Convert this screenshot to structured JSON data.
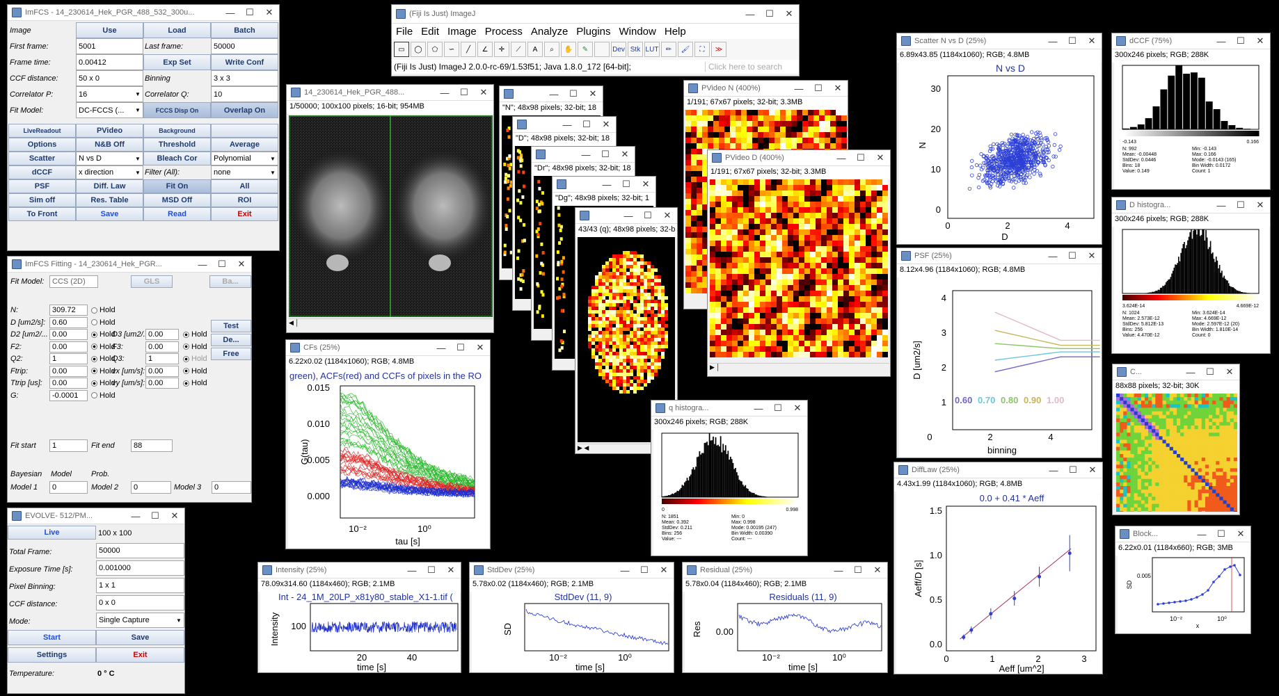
{
  "imfcs": {
    "title": "ImFCS - 14_230614_Hek_PGR_488_532_300u...",
    "rows": [
      [
        "Image",
        "Use",
        "Load",
        "Batch"
      ],
      [
        "First frame:",
        "5001",
        "Last frame:",
        "50000"
      ],
      [
        "Frame time:",
        "0.00412",
        "Exp Set",
        "Write Conf"
      ],
      [
        "CCF distance:",
        "50 x 0",
        "Binning",
        "3 x 3"
      ],
      [
        "Correlator P:",
        "16",
        "Correlator Q:",
        "10"
      ],
      [
        "Fit Model:",
        "DC-FCCS (...",
        "FCCS Disp On",
        "Overlap On"
      ]
    ],
    "buttons": [
      [
        "LiveReadout",
        "PVideo",
        "Background",
        ""
      ],
      [
        "Options",
        "N&B Off",
        "Threshold",
        "Average"
      ],
      [
        "Scatter",
        "N vs D",
        "Bleach Cor",
        "Polynomial"
      ],
      [
        "dCCF",
        "x direction",
        "Filter (All):",
        "none"
      ],
      [
        "PSF",
        "Diff. Law",
        "Fit On",
        "All"
      ],
      [
        "Sim off",
        "Res. Table",
        "MSD Off",
        "ROI"
      ],
      [
        "To Front",
        "Save",
        "Read",
        "Exit"
      ]
    ]
  },
  "fitting": {
    "title": "ImFCS Fitting - 14_230614_Hek_PGR...",
    "fit_model_label": "Fit Model:",
    "fit_model": "CCS (2D)",
    "gls": "GLS",
    "ba": "Ba...",
    "side_buttons": [
      "Test",
      "De...",
      "Free"
    ],
    "params_left": [
      [
        "N:",
        "309.72",
        "Hold"
      ],
      [
        "D [um2/s]:",
        "0.60",
        "Hold"
      ],
      [
        "D2 [um2/...",
        "0.00",
        "Hold"
      ],
      [
        "F2:",
        "0.00",
        "Hold"
      ],
      [
        "Q2:",
        "1",
        "Hold"
      ],
      [
        "Ftrip:",
        "0.00",
        "Hold"
      ],
      [
        "Ttrip [us]:",
        "0.00",
        "Hold"
      ],
      [
        "G:",
        "-0.0001",
        "Hold"
      ]
    ],
    "params_right": [
      [
        "D3 [um2/...",
        "0.00",
        "Hold"
      ],
      [
        "F3:",
        "0.00",
        "Hold"
      ],
      [
        "Q3:",
        "1",
        "Hold"
      ],
      [
        "vx [um/s]:",
        "0.00",
        "Hold"
      ],
      [
        "vy [um/s]:",
        "0.00",
        "Hold"
      ]
    ],
    "fit_start_label": "Fit start",
    "fit_start": "1",
    "fit_end_label": "Fit end",
    "fit_end": "88",
    "bayes_header": [
      "Bayesian",
      "Model",
      "Prob."
    ],
    "models": [
      "Model 1",
      "0",
      "Model 2",
      "0",
      "Model 3",
      "0"
    ]
  },
  "evolve": {
    "title": "EVOLVE- 512/PM...",
    "live": "Live",
    "live_val": "100 x 100",
    "rows": [
      [
        "Total Frame:",
        "50000"
      ],
      [
        "Exposure Time [s]:",
        "0.001000"
      ],
      [
        "Pixel Binning:",
        "1 x 1"
      ],
      [
        "CCF distance:",
        "0 x 0"
      ],
      [
        "Mode:",
        "Single Capture"
      ]
    ],
    "start": "Start",
    "save": "Save",
    "settings": "Settings",
    "exit": "Exit",
    "temp_label": "Temperature:",
    "temp": "0 ° C"
  },
  "imagej": {
    "title": "(Fiji Is Just) ImageJ",
    "menus": [
      "File",
      "Edit",
      "Image",
      "Process",
      "Analyze",
      "Plugins",
      "Window",
      "Help"
    ],
    "tools": [
      "Dev",
      "Stk",
      "LUT"
    ],
    "status": "(Fiji Is Just) ImageJ 2.0.0-rc-69/1.53f51; Java 1.8.0_172 [64-bit];",
    "search": "Click here to search"
  },
  "stack": {
    "title": "14_230614_Hek_PGR_488...",
    "info": "1/50000; 100x100 pixels; 16-bit; 954MB"
  },
  "param_maps": [
    {
      "title": "",
      "info": "\"N\"; 48x98 pixels; 32-bit; 18"
    },
    {
      "title": "",
      "info": "\"D\"; 48x98 pixels; 32-bit; 18"
    },
    {
      "title": "",
      "info": "\"Dr\"; 48x98 pixels; 32-bit; 18"
    },
    {
      "title": "",
      "info": "\"Dg\"; 48x98 pixels; 32-bit; 1"
    },
    {
      "title": "",
      "info": "43/43 (q); 48x98 pixels; 32-b"
    }
  ],
  "pvideo_n": {
    "title": "PVideo N (400%)",
    "info": "1/191; 67x67 pixels; 32-bit; 3.3MB"
  },
  "pvideo_d": {
    "title": "PVideo D (400%)",
    "info": "1/191; 67x67 pixels; 32-bit; 3.3MB"
  },
  "cfs": {
    "title": "CFs (25%)",
    "info": "6.22x0.02  (1184x1060); RGB; 4.8MB",
    "plot_title": "green), ACFs(red) and CCFs of pixels in the RO",
    "ylabel": "G(tau)",
    "xlabel": "tau [s]",
    "yticks": [
      "0.015",
      "0.010",
      "0.005",
      "0.000"
    ],
    "xticks": [
      "10⁻²",
      "10⁰"
    ]
  },
  "q_hist": {
    "title": "q histogra...",
    "info": "300x246 pixels; RGB; 288K",
    "range": [
      "0",
      "0.998"
    ],
    "stats_left": [
      "N: 1851",
      "Mean: 0.392",
      "StdDev: 0.211",
      "Bins: 256",
      "Value: ---"
    ],
    "stats_right": [
      "Min: 0",
      "Max: 0.998",
      "Mode: 0.00195 (247)",
      "Bin Width: 0.00390",
      "Count: ---"
    ]
  },
  "scatter": {
    "title": "Scatter N vs D (25%)",
    "info": "6.89x43.85  (1184x1060); RGB; 4.8MB",
    "plot_title": "N vs D",
    "xlabel": "D",
    "ylabel": "N",
    "xticks": [
      "0",
      "2",
      "4"
    ],
    "yticks": [
      "30",
      "20",
      "10",
      "0"
    ]
  },
  "psf": {
    "title": "PSF (25%)",
    "info": "8.12x4.96  (1184x1060); RGB; 4.8MB",
    "xlabel": "binning",
    "ylabel": "D [um2/s]",
    "xticks": [
      "0",
      "2",
      "4"
    ],
    "yticks": [
      "4",
      "3",
      "2",
      "1"
    ],
    "legend": [
      "0.60",
      "0.70",
      "0.80",
      "0.90",
      "1.00"
    ]
  },
  "difflaw": {
    "title": "DiffLaw (25%)",
    "info": "4.43x1.99  (1184x1060); RGB; 4.8MB",
    "plot_title": "0.0 + 0.41 * Aeff",
    "xlabel": "Aeff [um^2]",
    "ylabel": "Aeff/D [s]",
    "xticks": [
      "0",
      "1",
      "2",
      "3"
    ],
    "yticks": [
      "1.5",
      "1.0",
      "0.5",
      "0.0"
    ]
  },
  "dccf": {
    "title": "dCCF (75%)",
    "info": "300x246 pixels; RGB; 288K",
    "range": [
      "-0.143",
      "0.166"
    ],
    "stats_left": [
      "N: 992",
      "Mean: -0.00448",
      "StdDev: 0.0446",
      "Bins: 18",
      "Value: 0.149"
    ],
    "stats_right": [
      "Min: -0.143",
      "Max: 0.166",
      "Mode: -0.0143 (165)",
      "Bin Width: 0.0172",
      "Count: 1"
    ]
  },
  "d_hist": {
    "title": "D histogra...",
    "info": "300x246 pixels; RGB; 288K",
    "range": [
      "3.624E-14",
      "4.669E-12"
    ],
    "stats_left": [
      "N: 1024",
      "Mean: 2.573E-12",
      "StdDev: 5.812E-13",
      "Bins: 256",
      "Value: 4.470E-12"
    ],
    "stats_right": [
      "Min: 3.624E-14",
      "Max: 4.669E-12",
      "Mode: 2.597E-12 (20)",
      "Bin Width: 1.810E-14",
      "Count: 0"
    ]
  },
  "corr_map": {
    "title": "C...",
    "info": "88x88 pixels; 32-bit; 30K"
  },
  "blocking": {
    "title": "Block...",
    "info": "6.22x0.01  (1184x660); RGB; 3MB",
    "ylabel": "SD",
    "ytick": "0.005",
    "xlabel": "x",
    "xticks": [
      "10⁻²",
      "10⁰"
    ]
  },
  "intensity": {
    "title": "Intensity (25%)",
    "info": "78.09x314.60  (1184x460); RGB; 2.1MB",
    "plot_title": "Int - 24_1M_20LP_x81y80_stable_X1-1.tif (",
    "ylabel": "Intensity",
    "xlabel": "time [s]",
    "ytick": "100",
    "xticks": [
      "20",
      "40"
    ]
  },
  "stddev": {
    "title": "StdDev (25%)",
    "info": "5.78x0.02  (1184x460); RGB; 2.1MB",
    "plot_title": "StdDev (11, 9)",
    "ylabel": "SD",
    "xlabel": "time [s]",
    "xticks": [
      "10⁻²",
      "10⁰"
    ]
  },
  "residual": {
    "title": "Residual (25%)",
    "info": "5.78x0.04  (1184x460); RGB; 2.1MB",
    "plot_title": "Residuals (11, 9)",
    "ylabel": "Res",
    "ytick": "0.00",
    "xlabel": "time [s]",
    "xticks": [
      "10⁻²",
      "10⁰"
    ]
  }
}
